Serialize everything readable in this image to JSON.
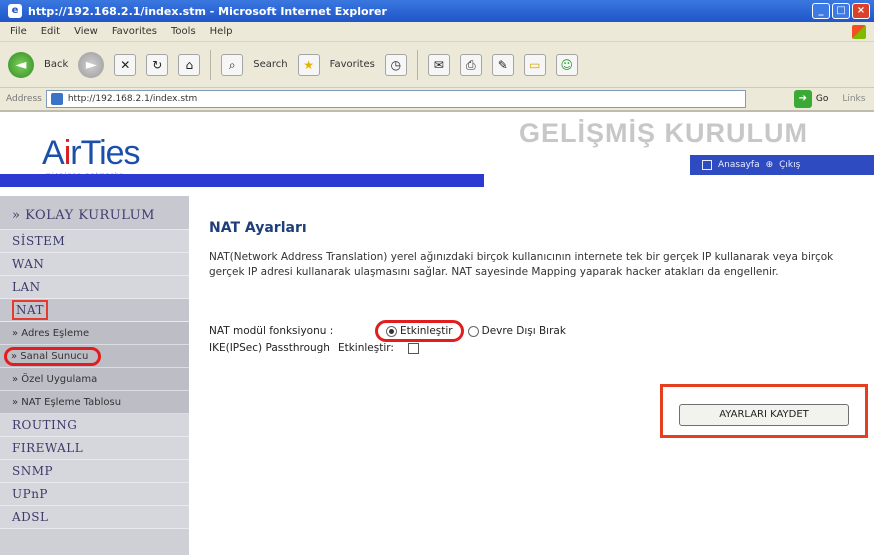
{
  "window": {
    "title": "http://192.168.2.1/index.stm - Microsoft Internet Explorer",
    "buttons": [
      "_",
      "□",
      "×"
    ]
  },
  "menubar": [
    "File",
    "Edit",
    "View",
    "Favorites",
    "Tools",
    "Help"
  ],
  "toolbar": {
    "back_label": "Back",
    "search_label": "Search",
    "favorites_label": "Favorites"
  },
  "address_bar": {
    "label": "Address",
    "url": "http://192.168.2.1/index.stm",
    "go_label": "Go",
    "links_label": "Links"
  },
  "header": {
    "logo_main": "AirTies",
    "logo_sub": "wireless networks",
    "page_heading": "GELİŞMİŞ KURULUM",
    "user_links": [
      "Anasayfa",
      "Çıkış"
    ]
  },
  "sidebar": {
    "items": [
      {
        "label": "» KOLAY KURULUM"
      },
      {
        "label": "SİSTEM"
      },
      {
        "label": "WAN"
      },
      {
        "label": "LAN"
      },
      {
        "label": "NAT"
      }
    ],
    "subitems": [
      {
        "label": "» Adres Eşleme"
      },
      {
        "label": "» Sanal Sunucu"
      },
      {
        "label": "» Özel Uygulama"
      },
      {
        "label": "» NAT Eşleme Tablosu"
      }
    ],
    "more_items": [
      {
        "label": "ROUTING"
      },
      {
        "label": "FIREWALL"
      },
      {
        "label": "SNMP"
      },
      {
        "label": "UPnP"
      },
      {
        "label": "ADSL"
      }
    ]
  },
  "main": {
    "title": "NAT Ayarları",
    "description": "NAT(Network Address Translation) yerel ağınızdaki birçok kullanıcının internete tek bir gerçek IP kullanarak veya birçok gerçek IP adresi kullanarak ulaşmasını sağlar. NAT sayesinde Mapping yaparak hacker atakları da engellenir.",
    "nat_module_label": "NAT modül fonksiyonu :",
    "option_enable": "Etkinleştir",
    "option_disable": "Devre Dışı Bırak",
    "ipsec_label": "IKE(IPSec) Passthrough",
    "ipsec_enable": "Etkinleştir:",
    "save_button": "AYARLARI KAYDET"
  }
}
